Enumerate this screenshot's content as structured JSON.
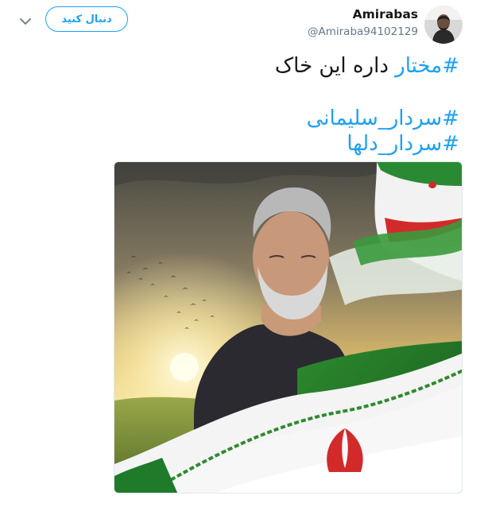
{
  "tweet": {
    "display_name": "Amirabas",
    "handle": "@Amiraba94102129",
    "follow_label": "دنبال کنید",
    "icons": {
      "menu": "chevron-down-icon",
      "avatar": "avatar"
    },
    "text": {
      "hashtag1": "#مختار",
      "line1_rest": " داره این خاک",
      "hashtag2": "#سردار_سلیمانی",
      "hashtag3": "#سردار_دلها"
    }
  },
  "colors": {
    "accent": "#1da1f2",
    "text": "#14171a",
    "secondary": "#657786"
  }
}
